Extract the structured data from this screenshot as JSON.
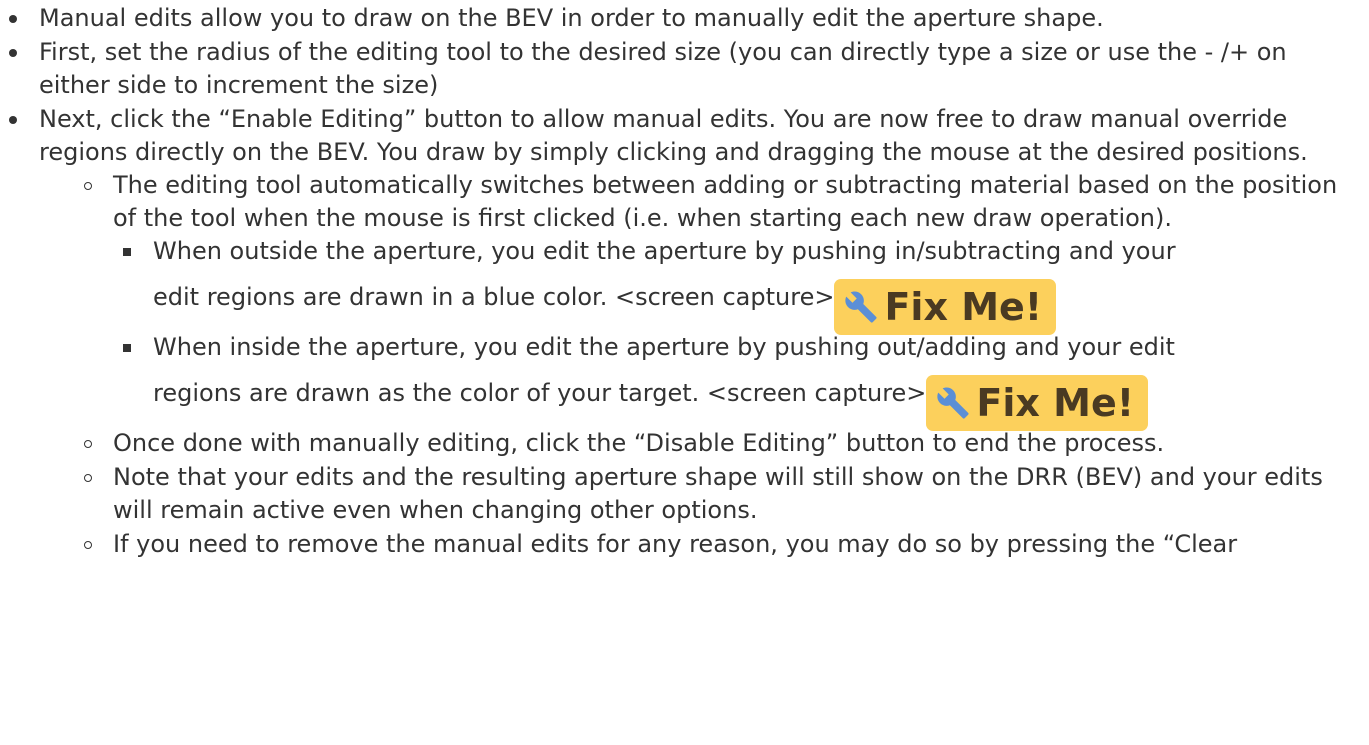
{
  "items": [
    "Manual edits allow you to draw on the BEV in order to manually edit the aperture shape.",
    "First, set the radius of the editing tool to the desired size (you can directly type a size or use the - /+ on either side to increment the size)",
    "Next, click the “Enable Editing” button to allow manual edits. You are now free to draw manual override regions directly on the BEV. You draw by simply clicking and dragging the mouse at the desired positions."
  ],
  "sub_items": {
    "tool_switch": "The editing tool automatically switches between adding or subtracting material based on the position of the tool when the mouse is first clicked (i.e. when starting each new draw operation).",
    "outside_line1": "When outside the aperture, you edit the aperture by pushing in/subtracting and your",
    "outside_line2": "edit regions are drawn in a blue color. <screen capture>",
    "inside_line1": "When inside the aperture, you edit the aperture by pushing out/adding and your edit",
    "inside_line2": "regions are drawn as the color of your target. <screen capture>",
    "disable": "Once done with manually editing, click the “Disable Editing” button to end the process.",
    "note": "Note that your edits and the resulting aperture shape will still show on the DRR (BEV) and your edits will remain active even when changing other options.",
    "clear": "If you need to remove the manual edits for any reason, you may do so by pressing the “Clear"
  },
  "fixme": {
    "label": "Fix Me!",
    "icon": "wrench-icon",
    "bg_color": "#fcd05c",
    "text_color": "#4a3a22"
  }
}
